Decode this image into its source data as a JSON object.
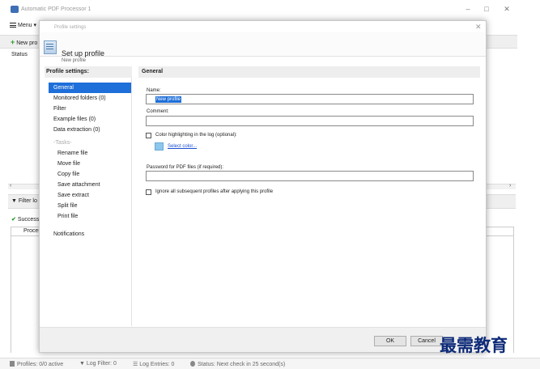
{
  "app": {
    "title": "Automatic PDF Processor 1",
    "window_controls": {
      "minimize": "–",
      "maximize": "□",
      "close": "✕"
    },
    "menu_label": "Menu",
    "menu_caret": "▾",
    "new_profile_label": "New pro",
    "status_column": "Status",
    "filter_log_label": "Filter lo",
    "success_tab_label": "Success",
    "process_column": "Proces",
    "scroll_left": "‹",
    "scroll_right": "›"
  },
  "statusbar": {
    "profiles": "Profiles: 0/0 active",
    "log_filter": "Log Filter: 0",
    "log_entries": "Log Entries: 0",
    "status": "Status: Next check in 25 second(s)"
  },
  "dialog": {
    "window_title": "Profile settings",
    "close_glyph": "✕",
    "header_title": "Set up profile",
    "header_subtitle": "New profile",
    "nav_heading": "Profile settings:",
    "nav_items": [
      "General",
      "Monitored folders (0)",
      "Filter",
      "Example files (0)",
      "Data extraction (0)",
      "-Tasks-",
      "Rename file",
      "Move file",
      "Copy file",
      "Save attachment",
      "Save extract",
      "Split file",
      "Print file",
      "Notifications"
    ],
    "active_nav_index": 0,
    "panel_heading": "General",
    "name_label": "Name:",
    "name_value": "New profile",
    "comment_label": "Comment:",
    "comment_value": "",
    "color_highlight_label": "Color highlighting in the log (optional):",
    "color_highlight_checked": false,
    "select_color_link": "Select color...",
    "highlight_color": "#8cc8ee",
    "password_label": "Password for PDF files (if required):",
    "password_value": "",
    "ignore_subsequent_label": "Ignore all subsequent profiles after applying this profile",
    "ignore_subsequent_checked": false,
    "ok_label": "OK",
    "cancel_label": "Cancel"
  },
  "watermark": "最需教育",
  "colors": {
    "accent": "#1e6fd9",
    "link": "#1a4fd0",
    "success": "#2e9b2e"
  }
}
